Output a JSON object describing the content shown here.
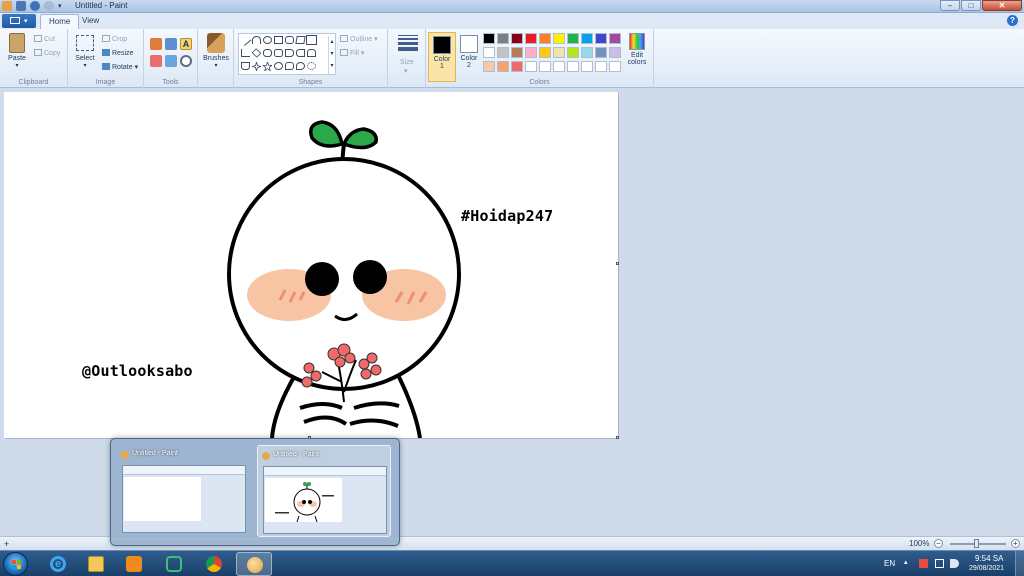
{
  "window": {
    "title": "Untitled - Paint",
    "minimize": "–",
    "maximize": "□",
    "close": "✕"
  },
  "tabs": [
    {
      "label": "Home"
    },
    {
      "label": "View"
    }
  ],
  "help": "?",
  "ribbon": {
    "clipboard": {
      "title": "Clipboard",
      "paste": "Paste",
      "cut": "Cut",
      "copy": "Copy"
    },
    "image": {
      "title": "Image",
      "select": "Select",
      "crop": "Crop",
      "resize": "Resize",
      "rotate": "Rotate"
    },
    "tools": {
      "title": "Tools"
    },
    "brushes": {
      "label": "Brushes"
    },
    "shapes": {
      "title": "Shapes",
      "outline": "Outline",
      "fill": "Fill"
    },
    "size": {
      "label": "Size"
    },
    "colors": {
      "title": "Colors",
      "color1_label": "Color",
      "color1_num": "1",
      "color1_value": "#000000",
      "color2_label": "Color",
      "color2_num": "2",
      "color2_value": "#ffffff",
      "edit_colors_line1": "Edit",
      "edit_colors_line2": "colors",
      "palette_row1": [
        "#000000",
        "#7f7f7f",
        "#880015",
        "#ed1c24",
        "#ff7f27",
        "#fff200",
        "#22b14c",
        "#00a2e8",
        "#3f48cc",
        "#a349a4"
      ],
      "palette_row2": [
        "#ffffff",
        "#c3c3c3",
        "#b97a57",
        "#ffaec9",
        "#ffc90e",
        "#efe4b0",
        "#b5e61d",
        "#99d9ea",
        "#7092be",
        "#c8bfe7"
      ],
      "palette_row3": [
        "#f7c9a8",
        "#f5a26f",
        "#f06a6a",
        "#ffffff",
        "#ffffff",
        "#ffffff",
        "#ffffff",
        "#ffffff",
        "#ffffff",
        "#ffffff"
      ]
    }
  },
  "canvas": {
    "text_hashtag": "#Hoidap247",
    "text_handle": "@Outlooksabo"
  },
  "status": {
    "zoom": "100%",
    "zoom_minus": "−",
    "zoom_plus": "+"
  },
  "thumbnails": [
    {
      "title": "Untitled - Paint"
    },
    {
      "title": "Untitled - Paint"
    }
  ],
  "taskbar": {
    "language": "EN",
    "time": "9:54 SA",
    "date": "29/08/2021"
  }
}
